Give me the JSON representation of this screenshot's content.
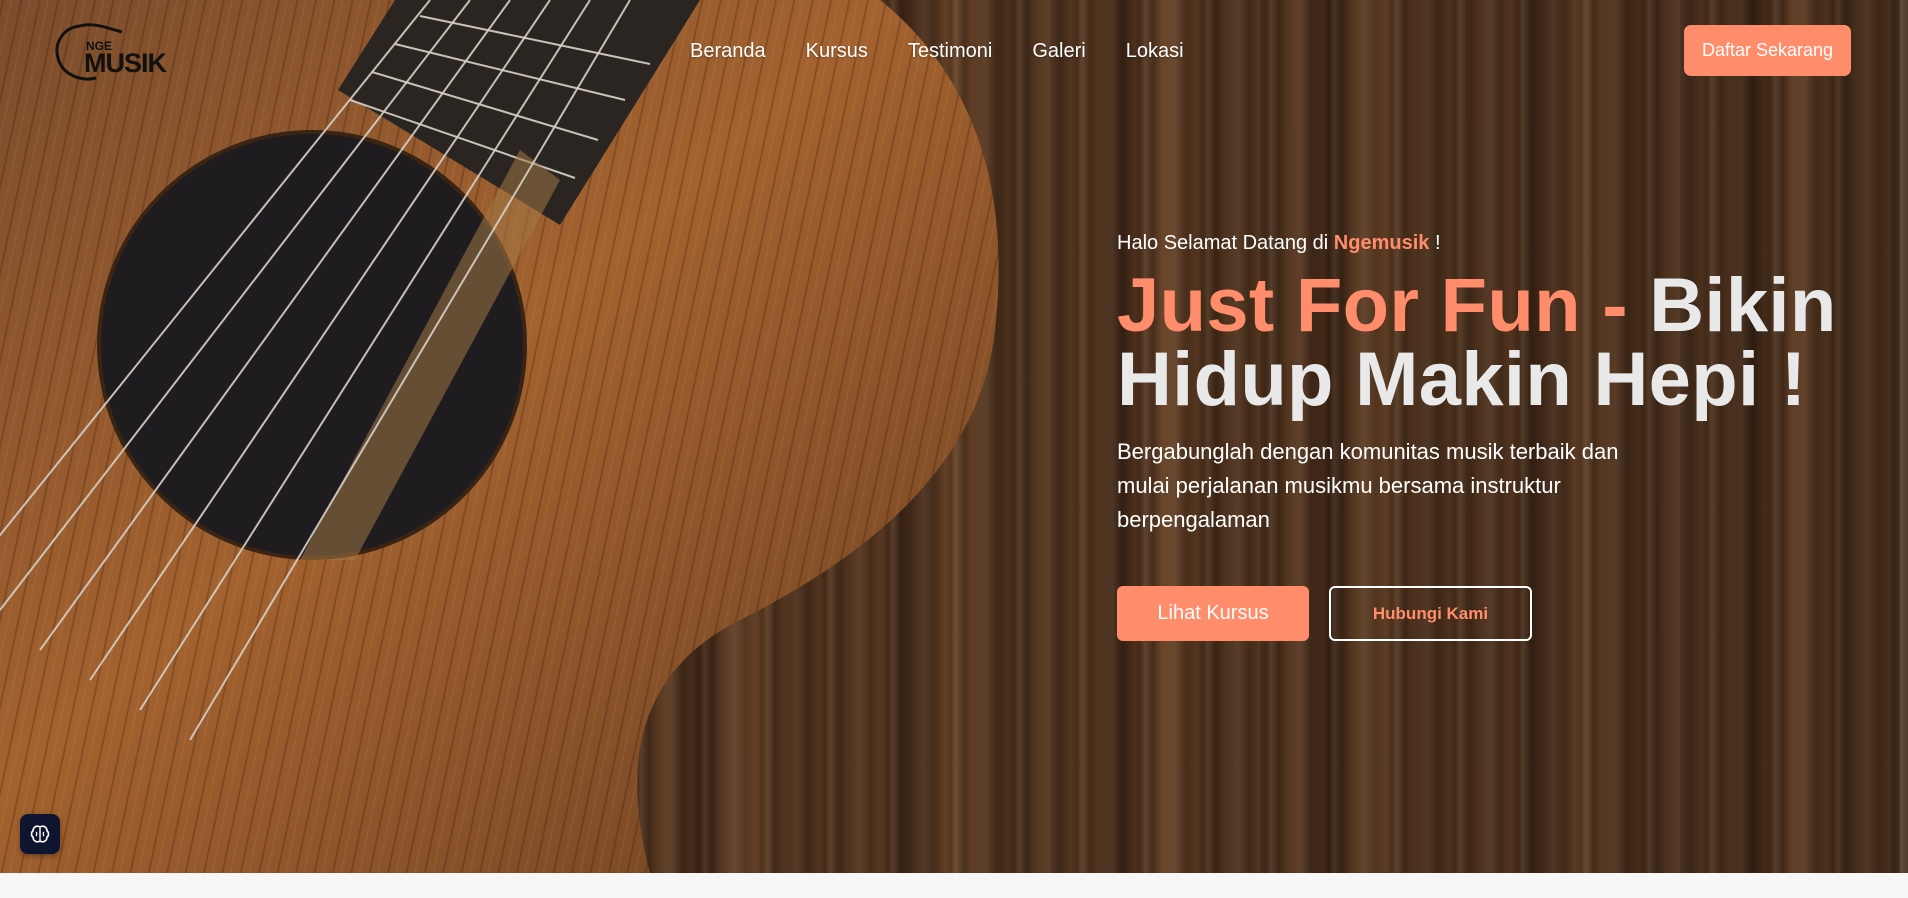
{
  "brand": {
    "logo_text_top": "NGE",
    "logo_text_main": "MUSIK"
  },
  "nav": {
    "items": [
      "Beranda",
      "Kursus",
      "Testimoni",
      "Galeri",
      "Lokasi"
    ],
    "cta": "Daftar Sekarang"
  },
  "hero": {
    "greeting_prefix": "Halo Selamat Datang di",
    "greeting_brand": "Ngemusik",
    "greeting_suffix": "!",
    "headline_accent": "Just For Fun -",
    "headline_rest": "Bikin Hidup Makin Hepi !",
    "description": "Bergabunglah dengan komunitas musik terbaik dan mulai perjalanan musikmu bersama instruktur berpengalaman",
    "primary_button": "Lihat Kursus",
    "secondary_button": "Hubungi Kami"
  },
  "widget": {
    "icon": "brain-icon"
  },
  "colors": {
    "accent": "#ff8c6b",
    "headline": "#e9e9e9",
    "widget_bg": "#0f1430"
  }
}
